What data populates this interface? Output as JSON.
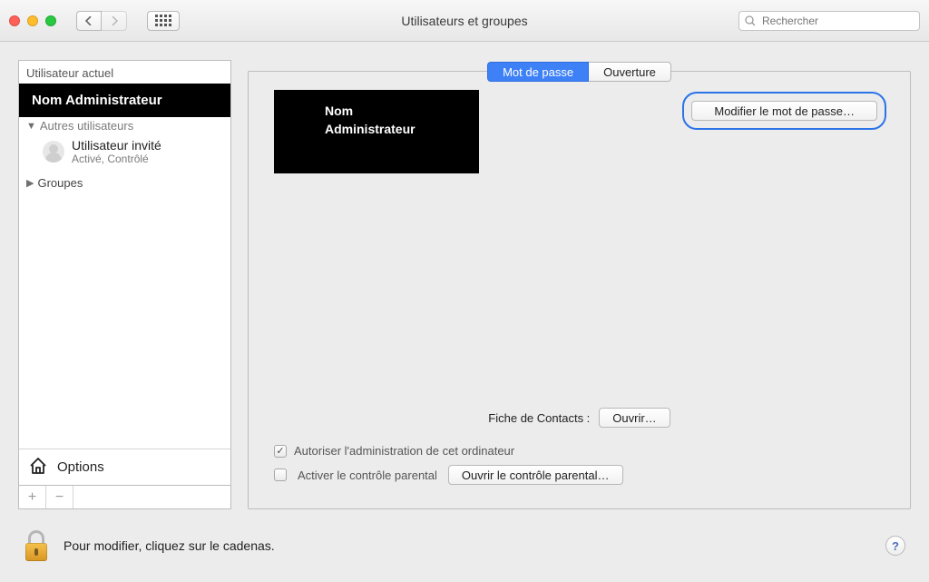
{
  "window": {
    "title": "Utilisateurs et groupes"
  },
  "search": {
    "placeholder": "Rechercher"
  },
  "sidebar": {
    "current_user_label": "Utilisateur actuel",
    "selected_user": "Nom Administrateur",
    "other_users_label": "Autres utilisateurs",
    "guest": {
      "name": "Utilisateur invité",
      "status": "Activé, Contrôlé"
    },
    "groups_label": "Groupes",
    "options_label": "Options"
  },
  "tabs": {
    "password": "Mot de passe",
    "login": "Ouverture"
  },
  "user_card": {
    "line1": "Nom",
    "line2": "Administrateur"
  },
  "actions": {
    "change_password": "Modifier le mot de passe…",
    "contacts_label": "Fiche de Contacts :",
    "open": "Ouvrir…",
    "allow_admin": "Autoriser l'administration de cet ordinateur",
    "enable_parental": "Activer le contrôle parental",
    "open_parental": "Ouvrir le contrôle parental…"
  },
  "footer": {
    "lock_hint": "Pour modifier, cliquez sur le cadenas."
  }
}
